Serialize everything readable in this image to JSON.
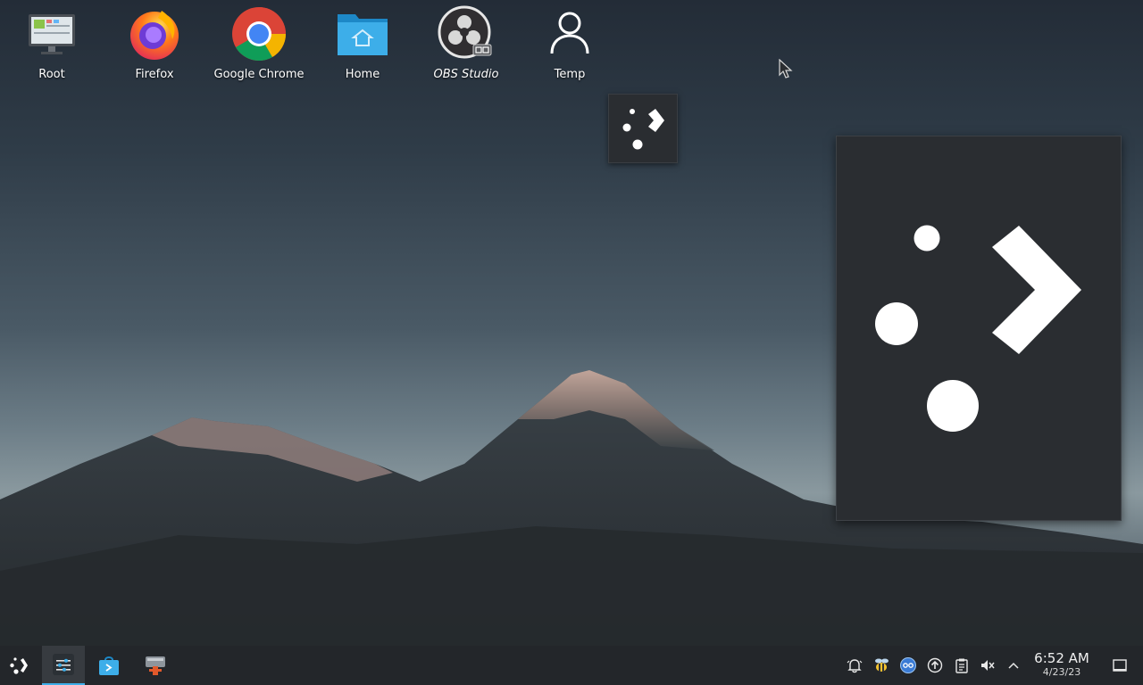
{
  "desktop": {
    "icons": [
      {
        "label": "Root",
        "icon": "computer-icon"
      },
      {
        "label": "Firefox",
        "icon": "firefox-icon"
      },
      {
        "label": "Google Chrome",
        "icon": "chrome-icon"
      },
      {
        "label": "Home",
        "icon": "home-folder-icon"
      },
      {
        "label": "OBS Studio",
        "icon": "obs-studio-icon"
      },
      {
        "label": "Temp",
        "icon": "user-icon"
      }
    ]
  },
  "taskbar": {
    "launcher": {
      "icon": "steam-deck-logo-icon"
    },
    "tasks": [
      {
        "icon": "system-settings-icon",
        "active": true
      },
      {
        "icon": "discover-store-icon",
        "active": false
      },
      {
        "icon": "installer-tool-icon",
        "active": false
      }
    ],
    "tray": [
      {
        "icon": "notifications-bell-icon"
      },
      {
        "icon": "bee-app-icon"
      },
      {
        "icon": "network-bubble-icon"
      },
      {
        "icon": "updates-arrow-icon"
      },
      {
        "icon": "clipboard-icon"
      },
      {
        "icon": "volume-muted-icon"
      },
      {
        "icon": "chevron-up-icon"
      }
    ],
    "clock": {
      "time": "6:52 AM",
      "date": "4/23/23"
    },
    "show_desktop": {
      "icon": "show-desktop-icon"
    }
  },
  "colors": {
    "accent": "#3daee9",
    "panel": "#23262a",
    "popup": "#2a2d31",
    "label_text": "#ffffff"
  }
}
